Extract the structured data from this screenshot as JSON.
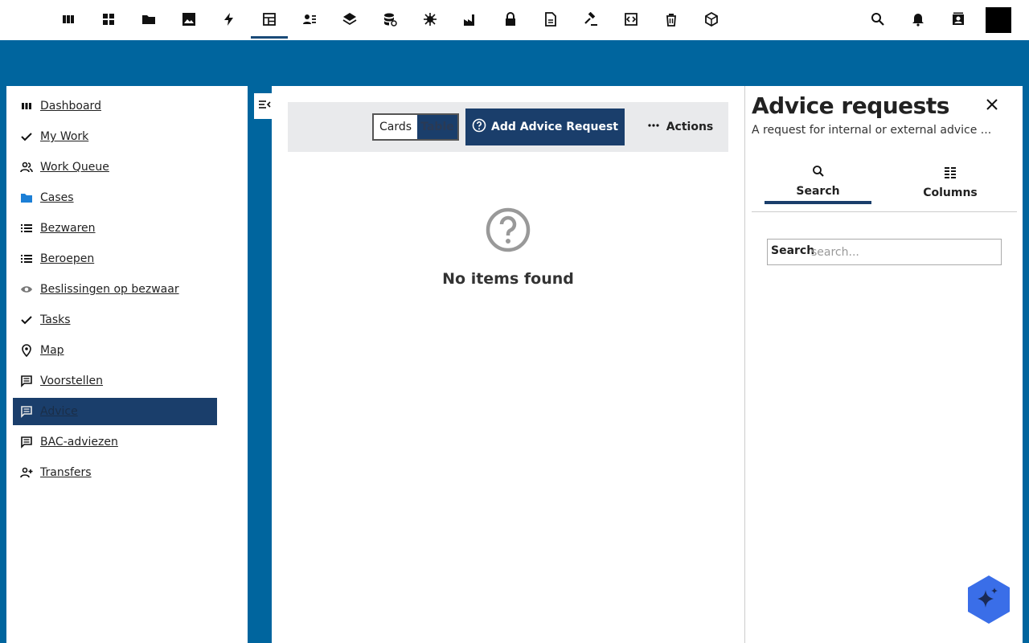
{
  "topbar": {
    "icons": [
      "board-icon",
      "grid-icon",
      "folder-icon",
      "image-icon",
      "bolt-icon",
      "table-icon",
      "person-list-icon",
      "layers-icon",
      "database-icon",
      "virus-icon",
      "factory-icon",
      "lock-icon",
      "document-icon",
      "gavel-icon",
      "code-icon",
      "trash-icon",
      "box-icon"
    ],
    "right_icons": [
      "search-icon",
      "bell-icon",
      "contact-icon"
    ]
  },
  "nav": {
    "items": [
      {
        "label": "Dashboard",
        "icon": "board-icon"
      },
      {
        "label": "My Work",
        "icon": "check-icon"
      },
      {
        "label": "Work Queue",
        "icon": "people-icon"
      },
      {
        "label": "Cases",
        "icon": "folder-icon"
      },
      {
        "label": "Bezwaren",
        "icon": "list-icon"
      },
      {
        "label": "Beroepen",
        "icon": "list-icon"
      },
      {
        "label": "Beslissingen op bezwaar",
        "icon": "eye-icon"
      },
      {
        "label": "Tasks",
        "icon": "check-icon"
      },
      {
        "label": "Map",
        "icon": "pin-icon"
      },
      {
        "label": "Voorstellen",
        "icon": "comment-icon"
      },
      {
        "label": "Advice",
        "icon": "comment-icon"
      },
      {
        "label": "BAC-adviezen",
        "icon": "comment-icon"
      },
      {
        "label": "Transfers",
        "icon": "person-add-icon"
      }
    ]
  },
  "toolbar": {
    "view_cards": "Cards",
    "view_table": "Table",
    "add_label": "Add Advice Request",
    "actions_label": "Actions"
  },
  "main": {
    "empty_text": "No items found"
  },
  "panel": {
    "title": "Advice requests",
    "description": "A request for internal or external advice ...",
    "tab_search": "Search",
    "tab_columns": "Columns",
    "search_label": "Search",
    "search_placeholder": "search..."
  },
  "colors": {
    "brand": "#00659e",
    "accent": "#1a3e6b",
    "fab": "#3a6ee8"
  }
}
